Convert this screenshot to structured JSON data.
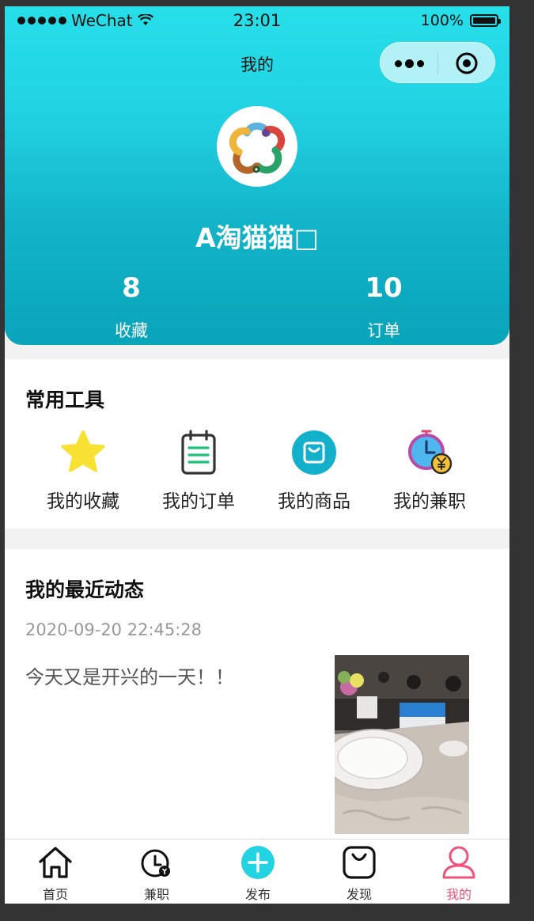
{
  "status_bar": {
    "carrier": "WeChat",
    "time": "23:01",
    "battery": "100%"
  },
  "nav": {
    "title": "我的"
  },
  "profile": {
    "username": "A淘猫猫",
    "missing_glyph": "□"
  },
  "stats": [
    {
      "value": "8",
      "label": "收藏"
    },
    {
      "value": "10",
      "label": "订单"
    }
  ],
  "tools": {
    "title": "常用工具",
    "items": [
      {
        "label": "我的收藏",
        "icon": "star-icon"
      },
      {
        "label": "我的订单",
        "icon": "notepad-icon"
      },
      {
        "label": "我的商品",
        "icon": "shopping-bag-icon"
      },
      {
        "label": "我的兼职",
        "icon": "clock-yen-icon"
      }
    ]
  },
  "recent": {
    "title": "我的最近动态",
    "time": "2020-09-20 22:45:28",
    "content": "今天又是开兴的一天！！"
  },
  "tabbar": [
    {
      "label": "首页",
      "icon": "home-icon"
    },
    {
      "label": "兼职",
      "icon": "clock-yen-icon"
    },
    {
      "label": "发布",
      "icon": "plus-circle-icon"
    },
    {
      "label": "发现",
      "icon": "bag-icon"
    },
    {
      "label": "我的",
      "icon": "user-icon",
      "active": true
    }
  ],
  "colors": {
    "header_top": "#26dfe9",
    "header_bottom": "#08a4ba",
    "active_tab": "#f0537a",
    "star": "#f7e234",
    "accent_green": "#1ec27a"
  }
}
